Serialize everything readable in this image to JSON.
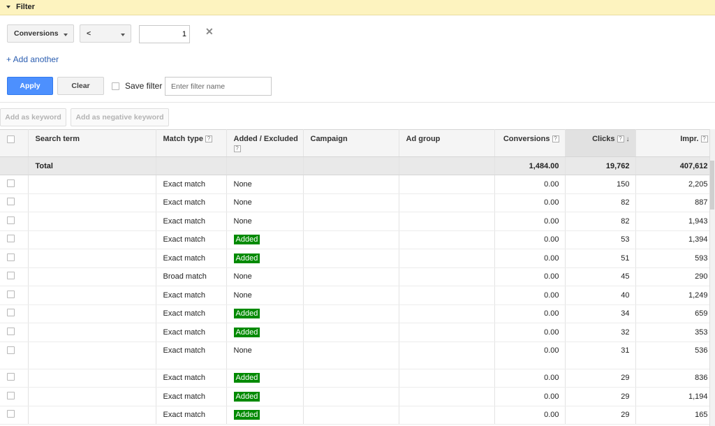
{
  "filter": {
    "title": "Filter",
    "metric": "Conversions",
    "operator": "<",
    "value": "1",
    "add_another": "+ Add another",
    "apply": "Apply",
    "clear": "Clear",
    "save_filter": "Save filter",
    "filter_name_placeholder": "Enter filter name"
  },
  "actions": {
    "add_keyword": "Add as keyword",
    "add_negative_keyword": "Add as negative keyword"
  },
  "table": {
    "headers": {
      "search_term": "Search term",
      "match_type": "Match type",
      "added_excluded": "Added / Excluded",
      "campaign": "Campaign",
      "ad_group": "Ad group",
      "conversions": "Conversions",
      "clicks": "Clicks",
      "impr": "Impr.",
      "help": "?"
    },
    "total": {
      "label": "Total",
      "conversions": "1,484.00",
      "clicks": "19,762",
      "impr": "407,612"
    },
    "rows": [
      {
        "match": "Exact match",
        "status": "None",
        "conversions": "0.00",
        "clicks": "150",
        "impr": "2,205"
      },
      {
        "match": "Exact match",
        "status": "None",
        "conversions": "0.00",
        "clicks": "82",
        "impr": "887"
      },
      {
        "match": "Exact match",
        "status": "None",
        "conversions": "0.00",
        "clicks": "82",
        "impr": "1,943"
      },
      {
        "match": "Exact match",
        "status": "Added",
        "conversions": "0.00",
        "clicks": "53",
        "impr": "1,394"
      },
      {
        "match": "Exact match",
        "status": "Added",
        "conversions": "0.00",
        "clicks": "51",
        "impr": "593"
      },
      {
        "match": "Broad match",
        "status": "None",
        "conversions": "0.00",
        "clicks": "45",
        "impr": "290"
      },
      {
        "match": "Exact match",
        "status": "None",
        "conversions": "0.00",
        "clicks": "40",
        "impr": "1,249"
      },
      {
        "match": "Exact match",
        "status": "Added",
        "conversions": "0.00",
        "clicks": "34",
        "impr": "659"
      },
      {
        "match": "Exact match",
        "status": "Added",
        "conversions": "0.00",
        "clicks": "32",
        "impr": "353"
      },
      {
        "match": "Exact match",
        "status": "None",
        "conversions": "0.00",
        "clicks": "31",
        "impr": "536"
      },
      {
        "match": "Exact match",
        "status": "Added",
        "conversions": "0.00",
        "clicks": "29",
        "impr": "836"
      },
      {
        "match": "Exact match",
        "status": "Added",
        "conversions": "0.00",
        "clicks": "29",
        "impr": "1,194"
      },
      {
        "match": "Exact match",
        "status": "Added",
        "conversions": "0.00",
        "clicks": "29",
        "impr": "165"
      }
    ]
  },
  "colors": {
    "filter_bar": "#fdf3bf",
    "apply_button": "#4d90fe",
    "added_badge": "#008a00",
    "link": "#2a5db0"
  }
}
